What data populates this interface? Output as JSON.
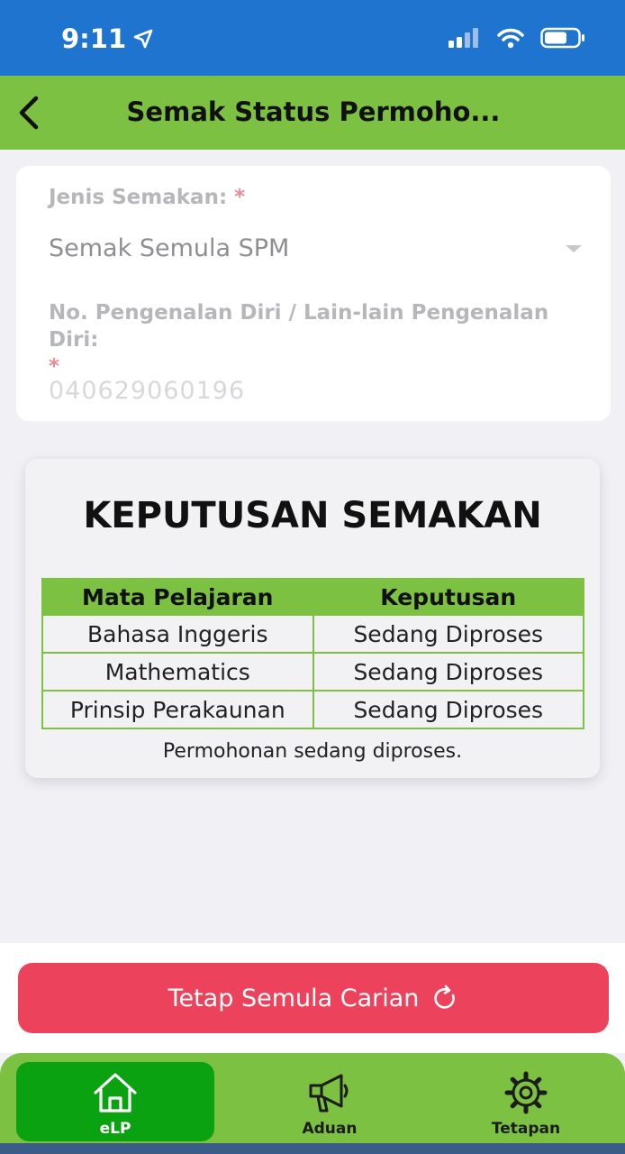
{
  "status_bar": {
    "time": "9:11"
  },
  "header": {
    "title": "Semak Status Permoho..."
  },
  "form": {
    "type_label": "Jenis Semakan:",
    "type_value": "Semak Semula SPM",
    "id_label": "No. Pengenalan Diri / Lain-lain Pengenalan Diri:",
    "id_value": "040629060196",
    "required_mark": "*"
  },
  "result": {
    "title": "KEPUTUSAN SEMAKAN",
    "columns": [
      "Mata Pelajaran",
      "Keputusan"
    ],
    "rows": [
      [
        "Bahasa Inggeris",
        "Sedang Diproses"
      ],
      [
        "Mathematics",
        "Sedang Diproses"
      ],
      [
        "Prinsip Perakaunan",
        "Sedang Diproses"
      ]
    ],
    "note": "Permohonan sedang diproses."
  },
  "actions": {
    "reset_label": "Tetap Semula Carian"
  },
  "tabs": [
    {
      "label": "eLP",
      "icon": "home-icon",
      "active": true
    },
    {
      "label": "Aduan",
      "icon": "megaphone-icon",
      "active": false
    },
    {
      "label": "Tetapan",
      "icon": "gear-icon",
      "active": false
    }
  ],
  "colors": {
    "status_bar": "#1f74cf",
    "accent_green": "#7cc142",
    "active_tab": "#0ba212",
    "reset_button": "#ec425b"
  }
}
